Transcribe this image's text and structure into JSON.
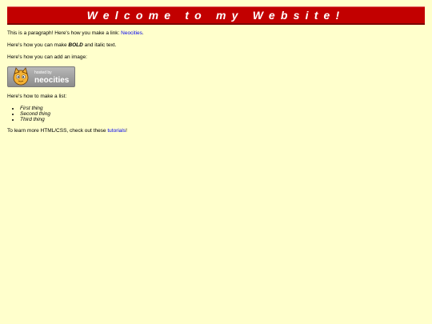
{
  "banner": {
    "title": "Welcome to my Website!"
  },
  "content": {
    "p1_text": "This is a paragraph! Here's how you make a link: ",
    "p1_link": "Neocities",
    "p1_end": ".",
    "p2_pre": "Here's how you can make ",
    "p2_bold": "BOLD",
    "p2_post": " and italic text.",
    "p3_text": "Here's how you can add an image:",
    "badge_small": "hosted by",
    "badge_big": "neocities",
    "p4_text": "Here's how to make a list:",
    "list": [
      "First thing",
      "Second thing",
      "Third thing"
    ],
    "p5_pre": "To learn more HTML/CSS, check out these ",
    "p5_link": "tutorials",
    "p5_end": "!"
  },
  "colors": {
    "background": "#ffffcc",
    "banner": "#c20000",
    "link": "#0000ee"
  }
}
